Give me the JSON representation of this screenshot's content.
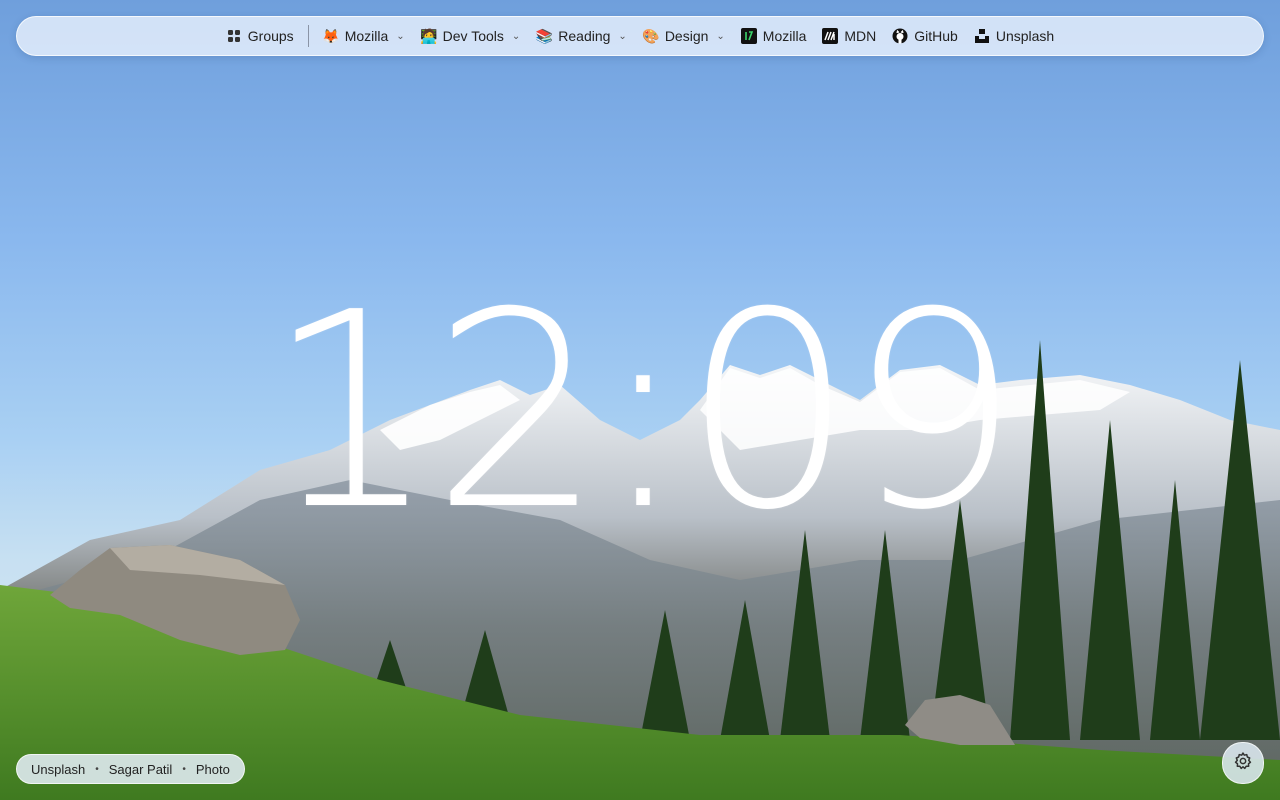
{
  "bookmarks": {
    "groups_label": "Groups",
    "items": [
      {
        "label": "Mozilla",
        "icon": "fox-icon",
        "emoji": "🦊",
        "dropdown": true
      },
      {
        "label": "Dev Tools",
        "icon": "technologist-icon",
        "emoji": "🧑‍💻",
        "dropdown": true
      },
      {
        "label": "Reading",
        "icon": "books-icon",
        "emoji": "📚",
        "dropdown": true
      },
      {
        "label": "Design",
        "icon": "palette-icon",
        "emoji": "🎨",
        "dropdown": true
      },
      {
        "label": "Mozilla",
        "icon": "mozilla-icon",
        "dropdown": false
      },
      {
        "label": "MDN",
        "icon": "mdn-icon",
        "dropdown": false
      },
      {
        "label": "GitHub",
        "icon": "github-icon",
        "dropdown": false
      },
      {
        "label": "Unsplash",
        "icon": "unsplash-icon",
        "dropdown": false
      }
    ]
  },
  "clock": {
    "time": "12:09"
  },
  "credit": {
    "source": "Unsplash",
    "author": "Sagar Patil",
    "link": "Photo"
  },
  "colors": {
    "sky_top": "#6f9fdc",
    "grass": "#4f8a2a",
    "bar_bg": "#e8f0fc"
  }
}
